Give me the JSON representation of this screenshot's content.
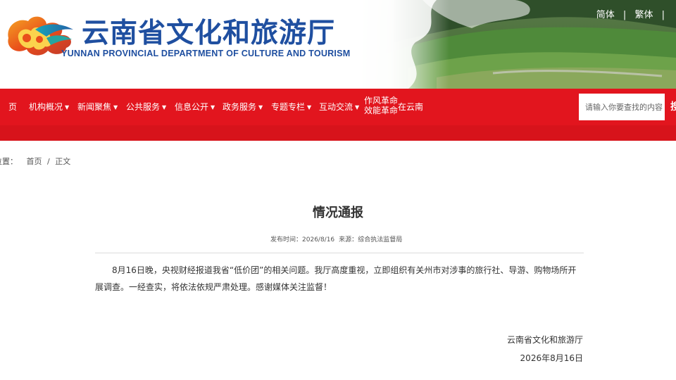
{
  "header": {
    "title_cn": "云南省文化和旅游厅",
    "title_en": "YUNNAN PROVINCIAL DEPARTMENT OF CULTURE AND TOURISM",
    "lang": {
      "simplified": "简体",
      "traditional": "繁体",
      "sep": "|"
    }
  },
  "nav": {
    "items": [
      {
        "label": "页",
        "dropdown": false
      },
      {
        "label": "机构概况",
        "dropdown": true
      },
      {
        "label": "新闻聚焦",
        "dropdown": true
      },
      {
        "label": "公共服务",
        "dropdown": true
      },
      {
        "label": "信息公开",
        "dropdown": true
      },
      {
        "label": "政务服务",
        "dropdown": true
      },
      {
        "label": "专题专栏",
        "dropdown": true
      },
      {
        "label": "互动交流",
        "dropdown": true
      }
    ],
    "special": {
      "line1": "作风革命",
      "line2": "效能革命",
      "suffix": "在云南"
    },
    "caret": "▼",
    "search_placeholder": "请输入你要查找的内容",
    "search_button": "搜索"
  },
  "breadcrumb": {
    "prefix": "位置：",
    "home": "首页",
    "sep": "/",
    "current": "正文"
  },
  "article": {
    "title": "情况通报",
    "publish_label": "发布时间：",
    "publish_date": "2026/8/16",
    "source_label": "来源：",
    "source": "综合执法监督局",
    "body": "8月16日晚，央视财经报道我省“低价团”的相关问题。我厅高度重视，立即组织有关州市对涉事的旅行社、导游、购物场所开展调查。一经查实，将依法依规严肃处理。感谢媒体关注监督！",
    "signature_org": "云南省文化和旅游厅",
    "signature_date": "2026年8月16日"
  },
  "colors": {
    "nav_red": "#e2151e",
    "title_blue": "#1f4fa0"
  }
}
